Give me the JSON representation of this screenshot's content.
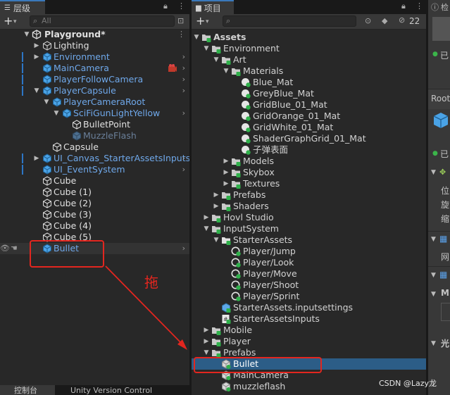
{
  "hierarchy": {
    "tab_label": "层级",
    "search_placeholder": "All",
    "scene_name": "Playground*",
    "items": [
      {
        "label": "Lighting",
        "depth": 1,
        "expand": "right",
        "icon": "gameobject-outline",
        "color": "white"
      },
      {
        "label": "Environment",
        "depth": 1,
        "expand": "right",
        "icon": "prefab-blue",
        "color": "blue",
        "chevron": true,
        "marker": true
      },
      {
        "label": "MainCamera",
        "depth": 1,
        "expand": "",
        "icon": "prefab-blue",
        "color": "blue",
        "chevron": true,
        "marker": true,
        "badge": true
      },
      {
        "label": "PlayerFollowCamera",
        "depth": 1,
        "expand": "",
        "icon": "prefab-blue",
        "color": "blue",
        "chevron": true,
        "marker": true
      },
      {
        "label": "PlayerCapsule",
        "depth": 1,
        "expand": "down",
        "icon": "prefab-blue",
        "color": "blue",
        "chevron": true,
        "marker": true
      },
      {
        "label": "PlayerCameraRoot",
        "depth": 2,
        "expand": "down",
        "icon": "prefab-blue",
        "color": "blue",
        "chevron": false
      },
      {
        "label": "SciFiGunLightYellow",
        "depth": 3,
        "expand": "down",
        "icon": "prefab-blue",
        "color": "blue",
        "chevron": true
      },
      {
        "label": "BulletPoint",
        "depth": 4,
        "expand": "",
        "icon": "gameobject-white",
        "color": "white"
      },
      {
        "label": "MuzzleFlash",
        "depth": 4,
        "expand": "",
        "icon": "prefab-dim",
        "color": "dim"
      },
      {
        "label": "Capsule",
        "depth": 2,
        "expand": "",
        "icon": "gameobject-white",
        "color": "white"
      },
      {
        "label": "UI_Canvas_StarterAssetsInputs",
        "depth": 1,
        "expand": "right",
        "icon": "prefab-blue",
        "color": "blue",
        "chevron": true,
        "marker": true
      },
      {
        "label": "UI_EventSystem",
        "depth": 1,
        "expand": "",
        "icon": "prefab-blue",
        "color": "blue",
        "chevron": true,
        "marker": true
      },
      {
        "label": "Cube",
        "depth": 1,
        "expand": "",
        "icon": "gameobject-white",
        "color": "white"
      },
      {
        "label": "Cube (1)",
        "depth": 1,
        "expand": "",
        "icon": "gameobject-white",
        "color": "white"
      },
      {
        "label": "Cube (2)",
        "depth": 1,
        "expand": "",
        "icon": "gameobject-white",
        "color": "white"
      },
      {
        "label": "Cube (3)",
        "depth": 1,
        "expand": "",
        "icon": "gameobject-white",
        "color": "white"
      },
      {
        "label": "Cube (4)",
        "depth": 1,
        "expand": "",
        "icon": "gameobject-white",
        "color": "white"
      },
      {
        "label": "Cube (5)",
        "depth": 1,
        "expand": "",
        "icon": "gameobject-white",
        "color": "white"
      },
      {
        "label": "Bullet",
        "depth": 1,
        "expand": "",
        "icon": "prefab-blue",
        "color": "blue",
        "chevron": true,
        "hover": true
      }
    ],
    "bottom_tabs": [
      "控制台",
      "Unity Version Control"
    ]
  },
  "annotation": {
    "drag_text": "拖",
    "watermark": "CSDN @Lazy龙"
  },
  "project": {
    "tab_label": "项目",
    "hidden_count": "22",
    "items": [
      {
        "label": "Assets",
        "depth": 0,
        "expand": "down",
        "icon": "folder",
        "bold": true
      },
      {
        "label": "Environment",
        "depth": 1,
        "expand": "down",
        "icon": "folder"
      },
      {
        "label": "Art",
        "depth": 2,
        "expand": "down",
        "icon": "folder"
      },
      {
        "label": "Materials",
        "depth": 3,
        "expand": "down",
        "icon": "folder"
      },
      {
        "label": "Blue_Mat",
        "depth": 4,
        "expand": "",
        "icon": "material"
      },
      {
        "label": "GreyBlue_Mat",
        "depth": 4,
        "expand": "",
        "icon": "material"
      },
      {
        "label": "GridBlue_01_Mat",
        "depth": 4,
        "expand": "",
        "icon": "material"
      },
      {
        "label": "GridOrange_01_Mat",
        "depth": 4,
        "expand": "",
        "icon": "material"
      },
      {
        "label": "GridWhite_01_Mat",
        "depth": 4,
        "expand": "",
        "icon": "material"
      },
      {
        "label": "ShaderGraphGrid_01_Mat",
        "depth": 4,
        "expand": "",
        "icon": "material"
      },
      {
        "label": "子弹表面",
        "depth": 4,
        "expand": "",
        "icon": "material"
      },
      {
        "label": "Models",
        "depth": 3,
        "expand": "right",
        "icon": "folder"
      },
      {
        "label": "Skybox",
        "depth": 3,
        "expand": "right",
        "icon": "folder"
      },
      {
        "label": "Textures",
        "depth": 3,
        "expand": "right",
        "icon": "folder"
      },
      {
        "label": "Prefabs",
        "depth": 2,
        "expand": "right",
        "icon": "folder"
      },
      {
        "label": "Shaders",
        "depth": 2,
        "expand": "right",
        "icon": "folder"
      },
      {
        "label": "Hovl Studio",
        "depth": 1,
        "expand": "right",
        "icon": "folder"
      },
      {
        "label": "InputSystem",
        "depth": 1,
        "expand": "down",
        "icon": "folder"
      },
      {
        "label": "StarterAssets",
        "depth": 2,
        "expand": "down",
        "icon": "inputasset"
      },
      {
        "label": "Player/Jump",
        "depth": 3,
        "expand": "",
        "icon": "action"
      },
      {
        "label": "Player/Look",
        "depth": 3,
        "expand": "",
        "icon": "action"
      },
      {
        "label": "Player/Move",
        "depth": 3,
        "expand": "",
        "icon": "action"
      },
      {
        "label": "Player/Shoot",
        "depth": 3,
        "expand": "",
        "icon": "action"
      },
      {
        "label": "Player/Sprint",
        "depth": 3,
        "expand": "",
        "icon": "action"
      },
      {
        "label": "StarterAssets.inputsettings",
        "depth": 2,
        "expand": "",
        "icon": "settings"
      },
      {
        "label": "StarterAssetsInputs",
        "depth": 2,
        "expand": "",
        "icon": "script"
      },
      {
        "label": "Mobile",
        "depth": 1,
        "expand": "right",
        "icon": "folder"
      },
      {
        "label": "Player",
        "depth": 1,
        "expand": "right",
        "icon": "folder"
      },
      {
        "label": "Prefabs",
        "depth": 1,
        "expand": "down",
        "icon": "folder"
      },
      {
        "label": "Bullet",
        "depth": 2,
        "expand": "",
        "icon": "prefab",
        "selected": true
      },
      {
        "label": "MainCamera",
        "depth": 2,
        "expand": "",
        "icon": "prefab"
      },
      {
        "label": "muzzleflash",
        "depth": 2,
        "expand": "",
        "icon": "prefab"
      }
    ]
  },
  "inspector": {
    "tab_label": "检",
    "root_text": "Root",
    "rows": [
      "已",
      "已",
      "位",
      "旋",
      "缩",
      "网",
      "M",
      "光"
    ]
  },
  "colors": {
    "accent_blue": "#2d76c5",
    "selection": "#2c5d87",
    "annotation_red": "#e3261f",
    "prefab_blue": "#6fa8ea",
    "material_green": "#2fb04a"
  }
}
